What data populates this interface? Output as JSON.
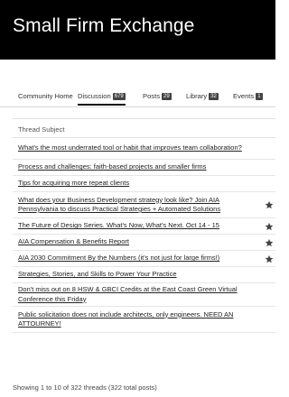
{
  "header": {
    "title": "Small Firm Exchange"
  },
  "tabs": [
    {
      "label": "Community Home",
      "badge": null
    },
    {
      "label": "Discussion",
      "badge": "679"
    },
    {
      "label": "Posts",
      "badge": "29"
    },
    {
      "label": "Library",
      "badge": "32"
    },
    {
      "label": "Events",
      "badge": "1"
    }
  ],
  "table": {
    "column_header": "Thread Subject",
    "rows": [
      {
        "subject": "What's the most underrated tool or habit that improves team collaboration?",
        "starred": false
      },
      {
        "subject": "Process and challenges: faith-based projects and smaller firms",
        "starred": false
      },
      {
        "subject": "Tips for acquiring more repeat clients",
        "starred": false
      },
      {
        "subject": "What does your Business Development strategy look like? Join AIA Pennsylvania to discuss Practical Strategies + Automated Solutions",
        "starred": true
      },
      {
        "subject": "The Future of Design Series. What's Now, What's Next. Oct 14 - 15",
        "starred": true
      },
      {
        "subject": "AIA Compensation & Benefits Report",
        "starred": true
      },
      {
        "subject": "AIA 2030 Commitment By the Numbers (it's not just for large firms!)",
        "starred": true
      },
      {
        "subject": "Strategies, Stories, and Skills to Power Your Practice",
        "starred": false
      },
      {
        "subject": "Don't miss out on 8 HSW & GBCI Credits at the East Coast Green Virtual Conference this Friday",
        "starred": false
      },
      {
        "subject": "Public solicitation does not include architects, only engineers. NEED AN ATTOURNEY!",
        "starred": false
      }
    ]
  },
  "footer": {
    "summary": "Showing 1 to 10 of 322 threads (322 total posts)"
  },
  "icons": {
    "pinned": "star-icon"
  }
}
